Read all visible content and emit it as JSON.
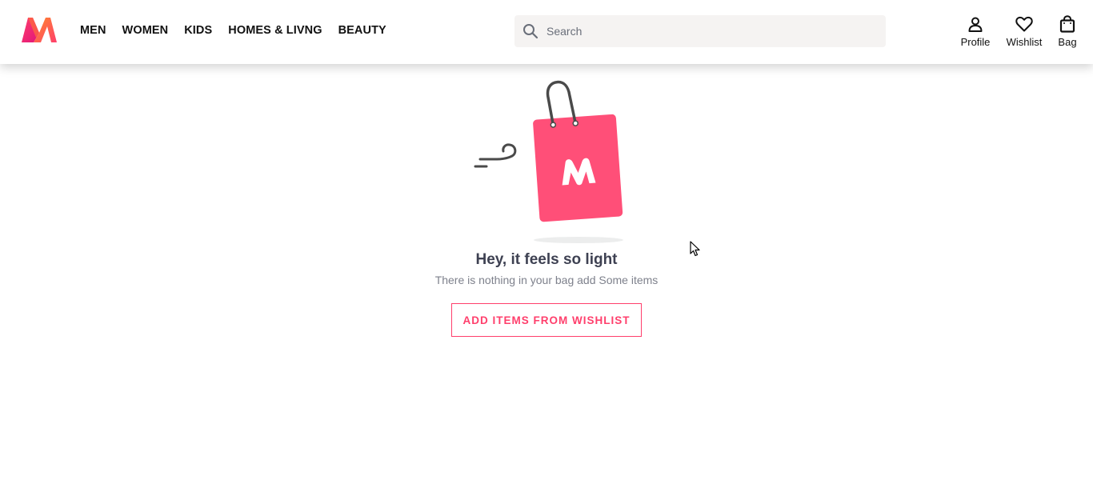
{
  "brand": {
    "logo_icon": "myntra-m-logo",
    "accent_color": "#ff3f6c"
  },
  "nav": {
    "items": [
      {
        "label": "MEN"
      },
      {
        "label": "WOMEN"
      },
      {
        "label": "KIDS"
      },
      {
        "label": "HOMES & LIVNG"
      },
      {
        "label": "BEAUTY"
      }
    ]
  },
  "search": {
    "placeholder": "Search",
    "value": "",
    "icon": "search-icon"
  },
  "actions": {
    "profile": {
      "label": "Profile",
      "icon": "person-icon"
    },
    "wishlist": {
      "label": "Wishlist",
      "icon": "heart-icon"
    },
    "bag": {
      "label": "Bag",
      "icon": "shopping-bag-icon"
    }
  },
  "empty_bag": {
    "illustration": "empty-shopping-bag-illustration",
    "title": "Hey, it feels so light",
    "subtitle": "There is nothing in your bag add Some items",
    "cta_label": "ADD ITEMS FROM WISHLIST"
  }
}
